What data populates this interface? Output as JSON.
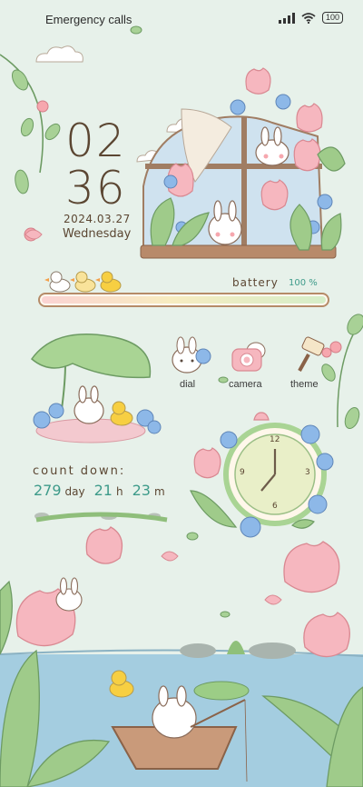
{
  "status_bar": {
    "carrier": "Emergency calls",
    "battery": "100",
    "icons": [
      "signal-icon",
      "wifi-icon",
      "battery-icon"
    ]
  },
  "clock": {
    "hours": "02",
    "minutes": "36",
    "date": "2024.03.27",
    "weekday": "Wednesday"
  },
  "battery_widget": {
    "label": "battery",
    "percent_text": "100 %",
    "level": 1.0
  },
  "apps": [
    {
      "label": "dial",
      "icon": "bunny-dial-icon"
    },
    {
      "label": "camera",
      "icon": "camera-icon"
    },
    {
      "label": "theme",
      "icon": "paintbrush-icon"
    }
  ],
  "countdown": {
    "title": "count down:",
    "days": "279",
    "days_unit": "day",
    "hours": "21",
    "hours_unit": "h",
    "minutes": "23",
    "minutes_unit": "m"
  },
  "analog_clock": {
    "numbers": [
      "12",
      "3",
      "6",
      "9"
    ]
  },
  "colors": {
    "background": "#e7f1ea",
    "text": "#5b4632",
    "accent": "#3e9b8a",
    "tulip": "#f6b7bf",
    "forget_me_not": "#8bb6e8",
    "leaf": "#9cc98a",
    "water": "#9fc9df"
  }
}
